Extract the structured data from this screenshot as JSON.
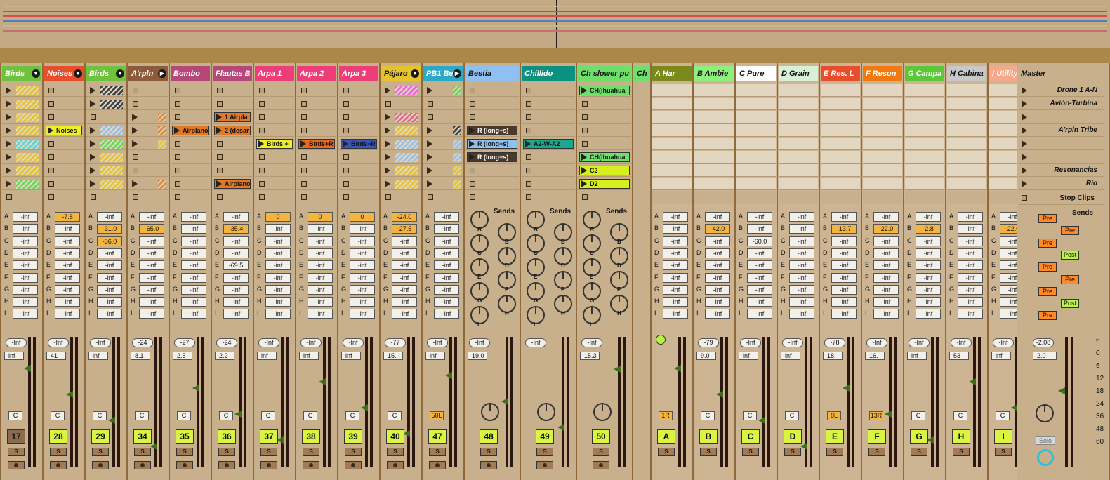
{
  "overview": {
    "lanes": [
      "#c9b68e",
      "#8a5f7f",
      "#d05050",
      "#5080c0",
      "#c9b68e",
      "#c27070"
    ]
  },
  "tracks": [
    {
      "name": "Birds",
      "color": "#6ec23c",
      "fold": "▼",
      "num": "17",
      "numStyle": "brown",
      "sends": [
        "-inf",
        "-inf",
        "-inf",
        "-inf",
        "-inf",
        "-inf",
        "-inf",
        "-inf",
        "-inf"
      ],
      "vol": "-Inf",
      "vol2": "-inf",
      "pan": "C",
      "clips": [
        {
          "type": "hatch",
          "c": "#e3c33a"
        },
        {
          "type": "hatch",
          "c": "#e3c33a"
        },
        {
          "type": "hatch",
          "c": "#e3c33a"
        },
        {
          "type": "hatch",
          "c": "#e3c33a"
        },
        {
          "type": "hatch",
          "c": "#5fd5d5"
        },
        {
          "type": "hatch",
          "c": "#e3c33a"
        },
        {
          "type": "hatch",
          "c": "#e3c33a"
        },
        {
          "type": "hatch",
          "c": "#6ed65a"
        }
      ]
    },
    {
      "name": "Noises",
      "color": "#e84e2c",
      "fold": "▼",
      "num": "28",
      "sends": [
        "-7.8",
        "-inf",
        "-inf",
        "-inf",
        "-inf",
        "-inf",
        "-inf",
        "-inf",
        "-inf"
      ],
      "sendsOn": [
        0
      ],
      "vol": "-Inf",
      "vol2": "-41",
      "pan": "C",
      "clips": [
        {
          "type": "stop"
        },
        {
          "type": "stop"
        },
        {
          "type": "stop"
        },
        {
          "type": "clip",
          "label": "Noises",
          "c": "#ecef2a"
        },
        {
          "type": "stop"
        },
        {
          "type": "stop"
        },
        {
          "type": "stop"
        },
        {
          "type": "stop"
        }
      ]
    },
    {
      "name": "Birds",
      "color": "#6ec23c",
      "fold": "▼",
      "num": "29",
      "sends": [
        "-inf",
        "-31.0",
        "-36.0",
        "-inf",
        "-inf",
        "-inf",
        "-inf",
        "-inf",
        "-inf"
      ],
      "sendsOn": [
        1,
        2
      ],
      "vol": "-Inf",
      "vol2": "-inf",
      "pan": "C",
      "clips": [
        {
          "type": "hatch",
          "c": "#444"
        },
        {
          "type": "hatch",
          "c": "#444"
        },
        {
          "type": "stop"
        },
        {
          "type": "hatch",
          "c": "#9bc0e2"
        },
        {
          "type": "hatch",
          "c": "#6ed65a"
        },
        {
          "type": "hatch",
          "c": "#e3c33a"
        },
        {
          "type": "hatch",
          "c": "#e3c33a"
        },
        {
          "type": "hatch",
          "c": "#e3c33a"
        }
      ]
    },
    {
      "name": "A'rpln",
      "color": "#8d5a3a",
      "fold": "▶",
      "num": "34",
      "sends": [
        "-inf",
        "-65.0",
        "-inf",
        "-inf",
        "-inf",
        "-inf",
        "-inf",
        "-inf",
        "-inf"
      ],
      "sendsOn": [
        1
      ],
      "vol": "-24",
      "vol2": "-8.1",
      "pan": "C",
      "clips": [
        {
          "type": "stop"
        },
        {
          "type": "stop"
        },
        {
          "type": "small",
          "c": "#e0883a"
        },
        {
          "type": "small",
          "c": "#e0883a"
        },
        {
          "type": "small",
          "c": "#e3c33a"
        },
        {
          "type": "stop"
        },
        {
          "type": "stop"
        },
        {
          "type": "small",
          "c": "#e0883a"
        }
      ]
    },
    {
      "name": "Bombo",
      "color": "#b54878",
      "num": "35",
      "sends": [
        "-inf",
        "-inf",
        "-inf",
        "-inf",
        "-inf",
        "-inf",
        "-inf",
        "-inf",
        "-inf"
      ],
      "vol": "-27",
      "vol2": "-2.5",
      "pan": "C",
      "clips": [
        {
          "type": "stop"
        },
        {
          "type": "stop"
        },
        {
          "type": "stop"
        },
        {
          "type": "clip",
          "label": "Airplano",
          "c": "#e07a28"
        },
        {
          "type": "stop"
        },
        {
          "type": "stop"
        },
        {
          "type": "stop"
        },
        {
          "type": "stop"
        }
      ]
    },
    {
      "name": "Flautas B",
      "color": "#b54878",
      "num": "36",
      "sends": [
        "-inf",
        "-35.4",
        "-inf",
        "-inf",
        "-69.5",
        "-inf",
        "-inf",
        "-inf",
        "-inf"
      ],
      "sendsOn": [
        1
      ],
      "vol": "-24",
      "vol2": "-2.2",
      "pan": "C",
      "clips": [
        {
          "type": "stop"
        },
        {
          "type": "stop"
        },
        {
          "type": "clip",
          "label": "1 Airpla",
          "c": "#e07a28"
        },
        {
          "type": "clip",
          "label": "2 (desar",
          "c": "#e07a28"
        },
        {
          "type": "stop"
        },
        {
          "type": "stop"
        },
        {
          "type": "stop"
        },
        {
          "type": "clip",
          "label": "Airplano",
          "c": "#e07a28"
        }
      ]
    },
    {
      "name": "Arpa 1",
      "color": "#ee3e78",
      "num": "37",
      "sends": [
        "0",
        "-inf",
        "-inf",
        "-inf",
        "-inf",
        "-inf",
        "-inf",
        "-inf",
        "-inf"
      ],
      "sendsOn": [
        0
      ],
      "vol": "-Inf",
      "vol2": "-inf",
      "pan": "C",
      "clips": [
        {
          "type": "stop"
        },
        {
          "type": "stop"
        },
        {
          "type": "stop"
        },
        {
          "type": "stop"
        },
        {
          "type": "clip",
          "label": "Birds +",
          "c": "#ecef2a"
        },
        {
          "type": "stop"
        },
        {
          "type": "stop"
        },
        {
          "type": "stop"
        }
      ]
    },
    {
      "name": "Arpa 2",
      "color": "#ee3e78",
      "num": "38",
      "sends": [
        "0",
        "-inf",
        "-inf",
        "-inf",
        "-inf",
        "-inf",
        "-inf",
        "-inf",
        "-inf"
      ],
      "sendsOn": [
        0
      ],
      "vol": "-Inf",
      "vol2": "-inf",
      "pan": "C",
      "clips": [
        {
          "type": "stop"
        },
        {
          "type": "stop"
        },
        {
          "type": "stop"
        },
        {
          "type": "stop"
        },
        {
          "type": "clip",
          "label": "Birds+R",
          "c": "#e86a20"
        },
        {
          "type": "stop"
        },
        {
          "type": "stop"
        },
        {
          "type": "stop"
        }
      ]
    },
    {
      "name": "Arpa 3",
      "color": "#ee3e78",
      "num": "39",
      "sends": [
        "0",
        "-inf",
        "-inf",
        "-inf",
        "-inf",
        "-inf",
        "-inf",
        "-inf",
        "-inf"
      ],
      "sendsOn": [
        0
      ],
      "vol": "-Inf",
      "vol2": "-inf",
      "pan": "C",
      "clips": [
        {
          "type": "stop"
        },
        {
          "type": "stop"
        },
        {
          "type": "stop"
        },
        {
          "type": "stop"
        },
        {
          "type": "clip",
          "label": "Birds+R",
          "c": "#3a56b8"
        },
        {
          "type": "stop"
        },
        {
          "type": "stop"
        },
        {
          "type": "stop"
        }
      ]
    },
    {
      "name": "Pájaro",
      "color": "#e6c22c",
      "fold": "▼",
      "num": "40",
      "sends": [
        "-24.0",
        "-27.5",
        "-inf",
        "-inf",
        "-inf",
        "-inf",
        "-inf",
        "-inf",
        "-inf"
      ],
      "sendsOn": [
        0,
        1
      ],
      "vol": "-77",
      "vol2": "-15.",
      "pan": "C",
      "clips": [
        {
          "type": "hatch",
          "c": "#f06ad8"
        },
        {
          "type": "stop"
        },
        {
          "type": "hatch",
          "c": "#e06a88"
        },
        {
          "type": "hatch",
          "c": "#e3c33a"
        },
        {
          "type": "hatch",
          "c": "#9bc0e2"
        },
        {
          "type": "hatch",
          "c": "#9bc0e2"
        },
        {
          "type": "hatch",
          "c": "#e3c33a"
        },
        {
          "type": "hatch",
          "c": "#e3c33a"
        }
      ]
    },
    {
      "name": "PB1 Be",
      "color": "#2ca8c8",
      "fold": "▶",
      "num": "47",
      "sends": [
        "-inf",
        "-inf",
        "-inf",
        "-inf",
        "-inf",
        "-inf",
        "-inf",
        "-inf",
        "-inf"
      ],
      "vol": "-Inf",
      "vol2": "-inf",
      "pan": "50L",
      "panOn": true,
      "clips": [
        {
          "type": "small",
          "c": "#6ed65a"
        },
        {
          "type": "stop"
        },
        {
          "type": "stop"
        },
        {
          "type": "small",
          "c": "#444"
        },
        {
          "type": "small",
          "c": "#9bc0e2"
        },
        {
          "type": "small",
          "c": "#9bc0e2"
        },
        {
          "type": "small",
          "c": "#e3c33a"
        },
        {
          "type": "small",
          "c": "#e3c33a"
        }
      ]
    },
    {
      "name": "Bestia",
      "color": "#8ec0f0",
      "wide": true,
      "num": "48",
      "knobs": true,
      "vol": "-Inf",
      "vol2": "-19.0",
      "clips": [
        {
          "type": "stop"
        },
        {
          "type": "stop"
        },
        {
          "type": "stop"
        },
        {
          "type": "clip",
          "label": "R (long+s)",
          "c": "#4a3a2e",
          "fc": "#fff"
        },
        {
          "type": "clip",
          "label": "R (long+s)",
          "c": "#8ec0f0"
        },
        {
          "type": "clip",
          "label": "R (long+s)",
          "c": "#4a3a2e",
          "fc": "#fff"
        },
        {
          "type": "stop"
        },
        {
          "type": "stop"
        }
      ]
    },
    {
      "name": "Chillido",
      "color": "#0c9080",
      "wide": true,
      "num": "49",
      "knobs": true,
      "vol": "-Inf",
      "vol2": "",
      "clips": [
        {
          "type": "stop"
        },
        {
          "type": "stop"
        },
        {
          "type": "stop"
        },
        {
          "type": "stop"
        },
        {
          "type": "clip",
          "label": "A2-W-A2",
          "c": "#1aa890"
        },
        {
          "type": "stop"
        },
        {
          "type": "stop"
        },
        {
          "type": "stop"
        }
      ]
    },
    {
      "name": "Ch slower pu",
      "color": "#6ee06a",
      "wide": true,
      "num": "50",
      "knobs": true,
      "vol": "-Inf",
      "vol2": "-15.3",
      "clips": [
        {
          "type": "clip",
          "label": "CH(ihuahua",
          "c": "#6ee06a"
        },
        {
          "type": "stop"
        },
        {
          "type": "stop"
        },
        {
          "type": "stop"
        },
        {
          "type": "stop"
        },
        {
          "type": "clip",
          "label": "CH(ihuahua",
          "c": "#6ee06a"
        },
        {
          "type": "clip",
          "label": "C2",
          "c": "#d8f020"
        },
        {
          "type": "clip",
          "label": "D2",
          "c": "#d8f020"
        }
      ]
    }
  ],
  "returns": [
    {
      "name": "A Har",
      "color": "#7a8a1a",
      "num": "A",
      "sends": [
        "-inf",
        "-inf",
        "-inf",
        "-inf",
        "-inf",
        "-inf",
        "-inf",
        "-inf",
        "-inf"
      ],
      "vol": "",
      "vol2": "",
      "pan": "1R",
      "panOn": true,
      "green": true
    },
    {
      "name": "B Ambie",
      "color": "#8ef07a",
      "num": "B",
      "sends": [
        "-inf",
        "-42.0",
        "-inf",
        "-inf",
        "-inf",
        "-inf",
        "-inf",
        "-inf",
        "-inf"
      ],
      "sendsOn": [
        1
      ],
      "vol": "-79",
      "vol2": "-9.0",
      "pan": "C"
    },
    {
      "name": "C Pure",
      "color": "#ffffff",
      "num": "C",
      "sends": [
        "-inf",
        "-inf",
        "-60.0",
        "-inf",
        "-inf",
        "-inf",
        "-inf",
        "-inf",
        "-inf"
      ],
      "vol": "-Inf",
      "vol2": "-inf",
      "pan": "C"
    },
    {
      "name": "D Grain",
      "color": "#d8f0d8",
      "num": "D",
      "sends": [
        "-inf",
        "-inf",
        "-inf",
        "-inf",
        "-inf",
        "-inf",
        "-inf",
        "-inf",
        "-inf"
      ],
      "vol": "-Inf",
      "vol2": "-inf",
      "pan": "C"
    },
    {
      "name": "E Res. L",
      "color": "#e84e2c",
      "num": "E",
      "sends": [
        "-inf",
        "-13.7",
        "-inf",
        "-inf",
        "-inf",
        "-inf",
        "-inf",
        "-inf",
        "-inf"
      ],
      "sendsOn": [
        1
      ],
      "vol": "-78",
      "vol2": "-18.",
      "pan": "8L",
      "panOn": true
    },
    {
      "name": "F Reson",
      "color": "#f07a10",
      "num": "F",
      "sends": [
        "-inf",
        "-22.0",
        "-inf",
        "-inf",
        "-inf",
        "-inf",
        "-inf",
        "-inf",
        "-inf"
      ],
      "sendsOn": [
        1
      ],
      "vol": "-Inf",
      "vol2": "-16.",
      "pan": "13R",
      "panOn": true
    },
    {
      "name": "G Campa",
      "color": "#5cc838",
      "num": "G",
      "sends": [
        "-inf",
        "-2.8",
        "-inf",
        "-inf",
        "-inf",
        "-inf",
        "-inf",
        "-inf",
        "-inf"
      ],
      "sendsOn": [
        1
      ],
      "vol": "-Inf",
      "vol2": "-inf",
      "pan": "C"
    },
    {
      "name": "H Cabina",
      "color": "#c8c8c8",
      "num": "H",
      "sends": [
        "-inf",
        "-inf",
        "-inf",
        "-inf",
        "-inf",
        "-inf",
        "-inf",
        "-inf",
        "-inf"
      ],
      "vol": "-Inf",
      "vol2": "-53",
      "pan": "C"
    },
    {
      "name": "I Utility |",
      "color": "#f8a888",
      "num": "I",
      "sends": [
        "-inf",
        "-22.0",
        "-inf",
        "-inf",
        "-inf",
        "-inf",
        "-inf",
        "-inf",
        "-inf"
      ],
      "sendsOn": [
        1
      ],
      "vol": "-Inf",
      "vol2": "-inf",
      "pan": "C"
    }
  ],
  "sendLetters": [
    "A",
    "B",
    "C",
    "D",
    "E",
    "F",
    "G",
    "H",
    "I"
  ],
  "sends_label": "Sends",
  "master": {
    "title": "Master",
    "scenes": [
      "Drone 1 A-N",
      "Avión-Turbina",
      "",
      "A'rpln Tribe",
      "",
      "",
      "Resonancias",
      "Río"
    ],
    "stop_clips": "Stop Clips",
    "sends_label": "Sends",
    "prepost": [
      "Pre",
      "Pre",
      "Pre",
      "Post",
      "Pre",
      "Pre",
      "Pre",
      "Post",
      "Pre"
    ],
    "vol": "-2.08",
    "vol2": "-2.0",
    "solo": "Solo",
    "scale": [
      "6",
      "0",
      "6",
      "12",
      "18",
      "24",
      "36",
      "48",
      "60"
    ]
  }
}
